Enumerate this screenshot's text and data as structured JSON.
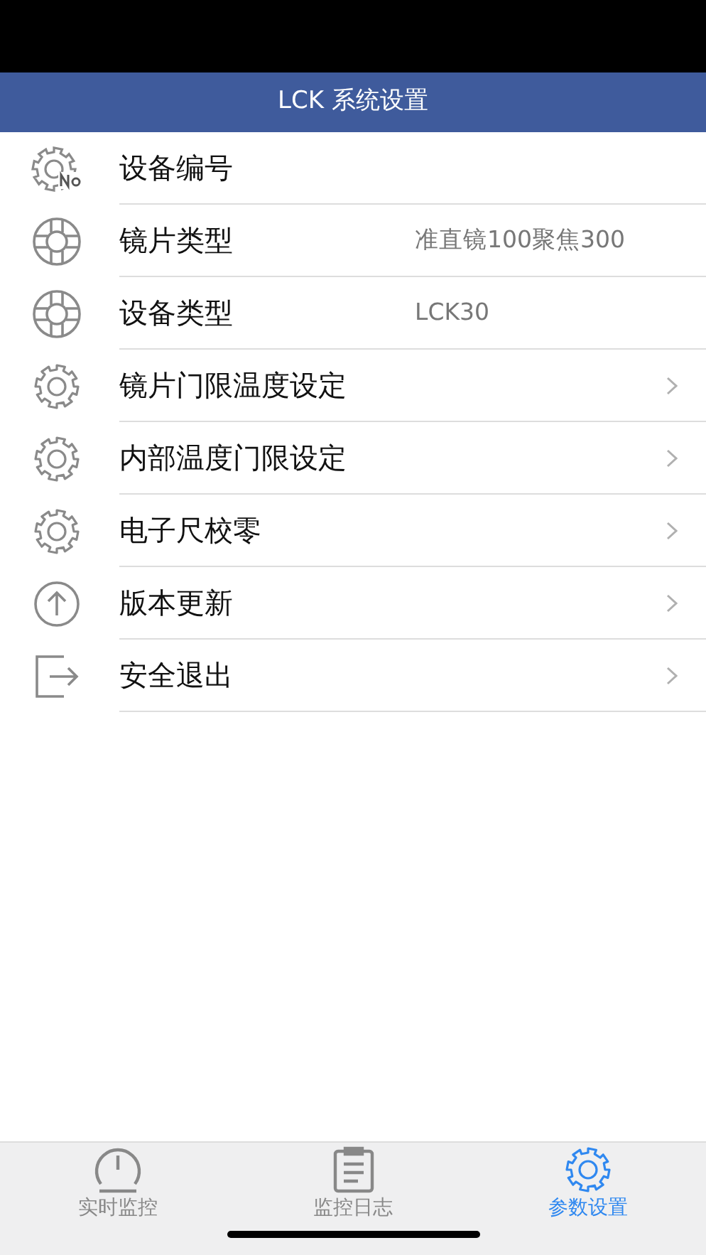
{
  "header": {
    "title": "LCK 系统设置"
  },
  "items": [
    {
      "kind": "gear-no",
      "label": "设备编号",
      "has_chevron": false
    },
    {
      "kind": "lifebuoy",
      "label": "镜片类型",
      "value": "准直镜100聚焦300",
      "has_chevron": false
    },
    {
      "kind": "lifebuoy",
      "label": "设备类型",
      "value": "LCK30",
      "has_chevron": false
    },
    {
      "kind": "gear",
      "label": "镜片门限温度设定",
      "has_chevron": true
    },
    {
      "kind": "gear",
      "label": "内部温度门限设定",
      "has_chevron": true
    },
    {
      "kind": "gear",
      "label": "电子尺校零",
      "has_chevron": true
    },
    {
      "kind": "upload",
      "label": "版本更新",
      "has_chevron": true
    },
    {
      "kind": "exit",
      "label": "安全退出",
      "has_chevron": true
    }
  ],
  "tabs": [
    {
      "kind": "gauge",
      "label": "实时监控",
      "selected": false
    },
    {
      "kind": "clipboard",
      "label": "监控日志",
      "selected": false
    },
    {
      "kind": "gear",
      "label": "参数设置",
      "selected": true
    }
  ]
}
